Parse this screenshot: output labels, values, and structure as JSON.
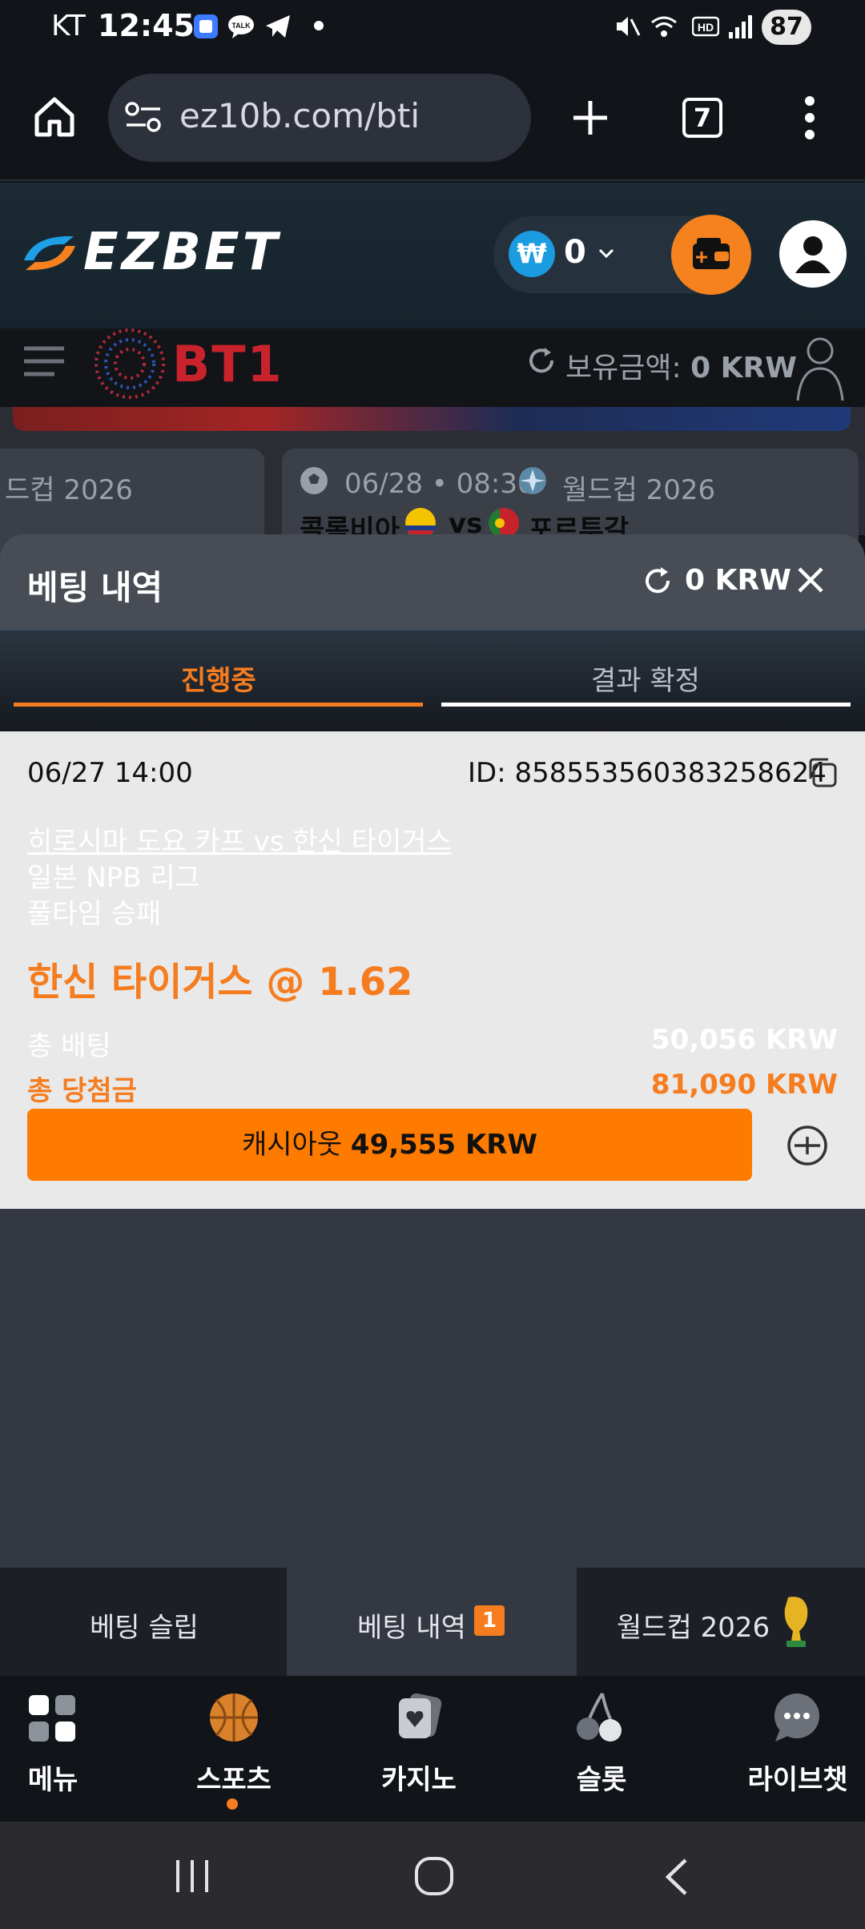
{
  "status_bar": {
    "carrier": "KT",
    "time": "12:45",
    "battery": "87"
  },
  "browser": {
    "url": "ez10b.com/bti",
    "tab_count": "7"
  },
  "site_header": {
    "logo": "EZBET",
    "wallet_amount": "0"
  },
  "bt_strip": {
    "brand": "BT1",
    "balance_label": "보유금액:",
    "balance_value": "0 KRW"
  },
  "background_cards": {
    "left_card_text": "드컵 2026",
    "right_card_datetime": "06/28 • 08:30",
    "right_card_league": "월드컵 2026",
    "right_card_team_a": "콜롬비아",
    "right_card_vs": "vs",
    "right_card_team_b": "포르투갈"
  },
  "modal": {
    "title": "베팅 내역",
    "amount": "0 KRW",
    "tabs": [
      {
        "label": "진행중",
        "active": true
      },
      {
        "label": "결과 확정",
        "active": false
      }
    ]
  },
  "bet": {
    "datetime": "06/27 14:00",
    "id": "ID: 858553560383258624",
    "match": "히로시마 도요 카프 vs 한신 타이거스",
    "league": "일본 NPB 리그",
    "market": "풀타임 승패",
    "pick": "한신 타이거스 @ 1.62",
    "total_bet_label": "총 배팅",
    "total_bet_value": "50,056 KRW",
    "total_win_label": "총 당첨금",
    "total_win_value": "81,090 KRW",
    "cashout_label": "캐시아웃",
    "cashout_value": "49,555 KRW"
  },
  "sub_tabs": [
    {
      "label": "베팅 슬립"
    },
    {
      "label": "베팅 내역",
      "badge": "1"
    },
    {
      "label": "월드컵 2026"
    }
  ],
  "bottom_nav": [
    {
      "label": "메뉴",
      "icon": "menu-grid-icon"
    },
    {
      "label": "스포츠",
      "icon": "basketball-icon",
      "active": true
    },
    {
      "label": "카지노",
      "icon": "casino-card-icon"
    },
    {
      "label": "슬롯",
      "icon": "cherry-icon"
    },
    {
      "label": "라이브챗",
      "icon": "chat-icon"
    }
  ],
  "colors": {
    "accent": "#f57c1f",
    "cashout_button": "#ff7b00",
    "card_bg": "#e9e9e9",
    "modal_header": "#474c55"
  }
}
